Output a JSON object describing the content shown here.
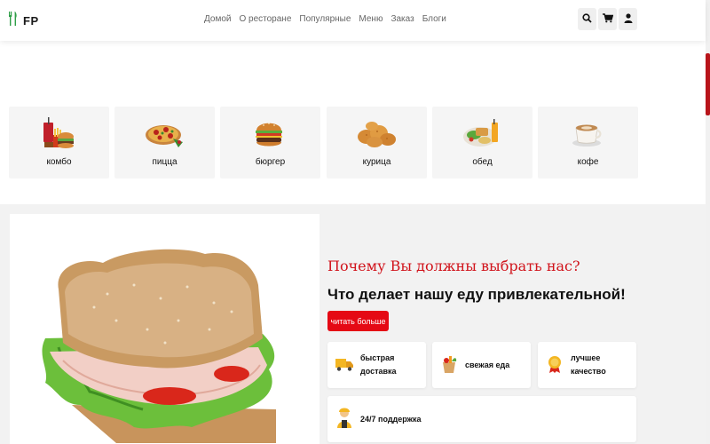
{
  "header": {
    "logo_text": "FP",
    "nav": [
      "Домой",
      "О ресторане",
      "Популярные",
      "Меню",
      "Заказ",
      "Блоги"
    ]
  },
  "categories": [
    {
      "label": "комбо",
      "icon": "combo-icon"
    },
    {
      "label": "пицца",
      "icon": "pizza-icon"
    },
    {
      "label": "бюргер",
      "icon": "burger-icon"
    },
    {
      "label": "курица",
      "icon": "chicken-icon"
    },
    {
      "label": "обед",
      "icon": "lunch-icon"
    },
    {
      "label": "кофе",
      "icon": "coffee-icon"
    }
  ],
  "why": {
    "subtitle": "Почему Вы должны выбрать нас?",
    "title": "Что делает нашу еду привлекательной!",
    "button": "читать больше"
  },
  "features": [
    {
      "label": "быстрая доставка",
      "icon": "delivery-icon"
    },
    {
      "label": "свежая еда",
      "icon": "fresh-food-icon"
    },
    {
      "label": "лучшее качество",
      "icon": "quality-icon"
    },
    {
      "label": "24/7 поддержка",
      "icon": "support-icon"
    }
  ],
  "colors": {
    "accent": "#e50914",
    "subtitle": "#d1141c",
    "logo_icon": "#2e9e47"
  }
}
